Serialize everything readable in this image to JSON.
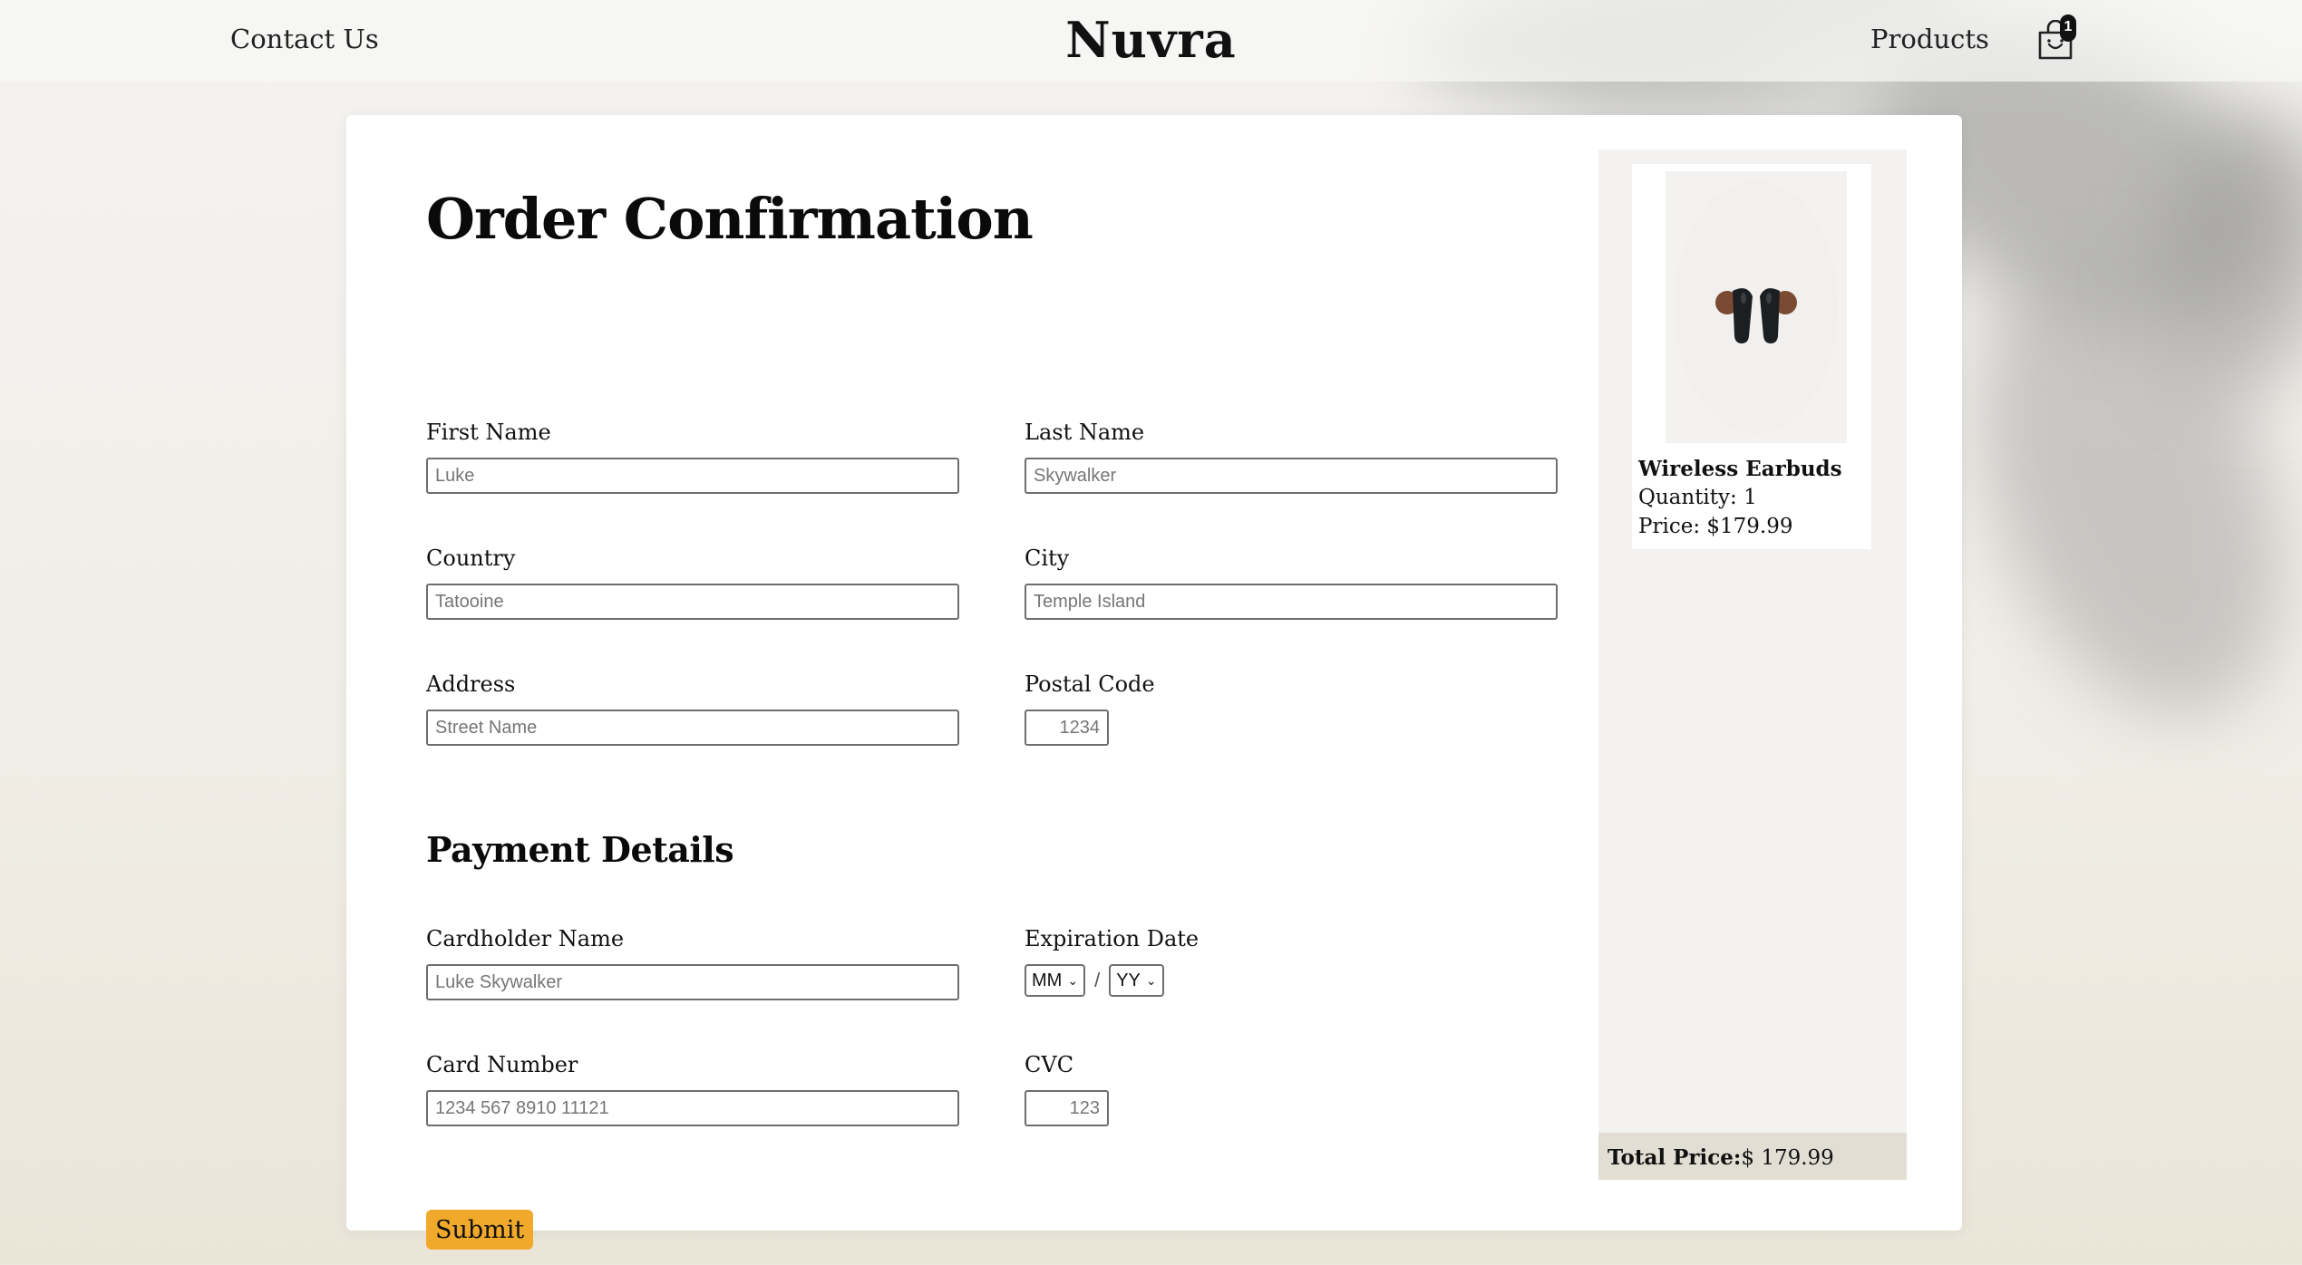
{
  "header": {
    "contact_label": "Contact Us",
    "brand": "Nuvra",
    "products_label": "Products",
    "cart_count": "1"
  },
  "form": {
    "title": "Order Confirmation",
    "first_name": {
      "label": "First Name",
      "placeholder": "Luke"
    },
    "last_name": {
      "label": "Last Name",
      "placeholder": "Skywalker"
    },
    "country": {
      "label": "Country",
      "placeholder": "Tatooine"
    },
    "city": {
      "label": "City",
      "placeholder": "Temple Island"
    },
    "address": {
      "label": "Address",
      "placeholder": "Street Name"
    },
    "postal_code": {
      "label": "Postal Code",
      "placeholder": "1234"
    }
  },
  "payment": {
    "title": "Payment Details",
    "cardholder": {
      "label": "Cardholder Name",
      "placeholder": "Luke Skywalker"
    },
    "expiration": {
      "label": "Expiration Date",
      "month": "MM",
      "year": "YY",
      "separator": "/"
    },
    "card_number": {
      "label": "Card Number",
      "placeholder": "1234 567 8910 11121"
    },
    "cvc": {
      "label": "CVC",
      "placeholder": "123"
    },
    "submit_label": "Submit"
  },
  "cart": {
    "items": [
      {
        "name": "Wireless Earbuds",
        "quantity": "Quantity: 1",
        "price": "Price: $179.99",
        "image_icon": "earbuds-image"
      }
    ],
    "total_label": "Total Price:",
    "total_value": "$ 179.99"
  },
  "colors": {
    "accent": "#f0a92a",
    "total_bar": "#e2ded4",
    "sidebar": "#f3f2f0"
  }
}
